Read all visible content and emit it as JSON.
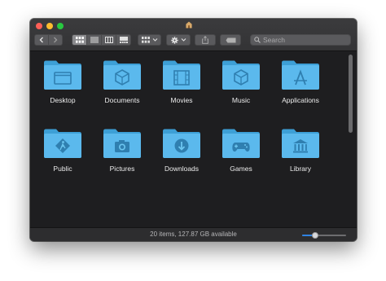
{
  "window": {
    "title_icon": "home-folder-icon",
    "accent": "#2f83e3",
    "folder_color": "#5bb9ed"
  },
  "toolbar": {
    "back_icon": "chevron-left-icon",
    "forward_icon": "chevron-right-icon",
    "view_modes": [
      "icon-view-icon",
      "list-view-icon",
      "column-view-icon",
      "gallery-view-icon"
    ],
    "selected_view": "icon-view-icon",
    "group_icon": "group-by-icon",
    "action_icon": "gear-icon",
    "share_icon": "share-icon",
    "tags_icon": "tag-icon"
  },
  "search": {
    "placeholder": "Search"
  },
  "items": [
    {
      "label": "Desktop",
      "icon": "desktop-folder-icon"
    },
    {
      "label": "Documents",
      "icon": "documents-folder-icon"
    },
    {
      "label": "Movies",
      "icon": "movies-folder-icon"
    },
    {
      "label": "Music",
      "icon": "music-folder-icon"
    },
    {
      "label": "Applications",
      "icon": "applications-folder-icon"
    },
    {
      "label": "Public",
      "icon": "public-folder-icon"
    },
    {
      "label": "Pictures",
      "icon": "pictures-folder-icon"
    },
    {
      "label": "Downloads",
      "icon": "downloads-folder-icon"
    },
    {
      "label": "Games",
      "icon": "games-folder-icon"
    },
    {
      "label": "Library",
      "icon": "library-folder-icon"
    }
  ],
  "status": {
    "text": "20 items, 127.87 GB available",
    "icon_size_fraction": 0.3
  }
}
